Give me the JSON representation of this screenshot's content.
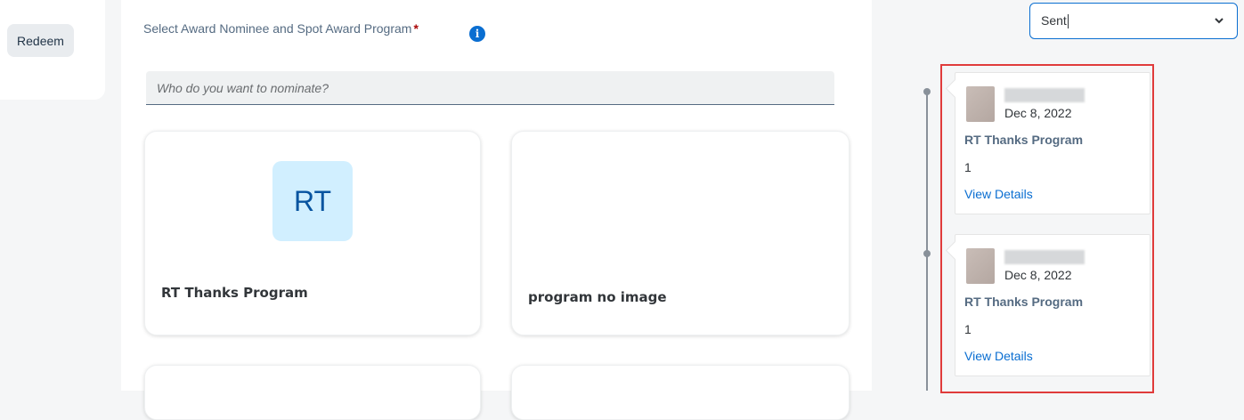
{
  "sidebar": {
    "redeem_label": "Redeem"
  },
  "main": {
    "select_label": "Select Award Nominee and Spot Award Program",
    "required_mark": "*",
    "info_icon": "info-icon",
    "search_placeholder": "Who do you want to nominate?",
    "programs": [
      {
        "initials": "RT",
        "title": "RT Thanks Program"
      },
      {
        "title": "program no image"
      }
    ]
  },
  "right": {
    "filter_value": "Sent",
    "history": [
      {
        "date": "Dec 8, 2022",
        "program": "RT Thanks Program",
        "count": "1",
        "link": "View Details"
      },
      {
        "date": "Dec 8, 2022",
        "program": "RT Thanks Program",
        "count": "1",
        "link": "View Details"
      }
    ]
  },
  "colors": {
    "accent": "#0a6ed1",
    "avatar_bg": "#d1efff",
    "avatar_text": "#0854a0",
    "highlight": "#e03b3b",
    "required": "#aa0808"
  }
}
